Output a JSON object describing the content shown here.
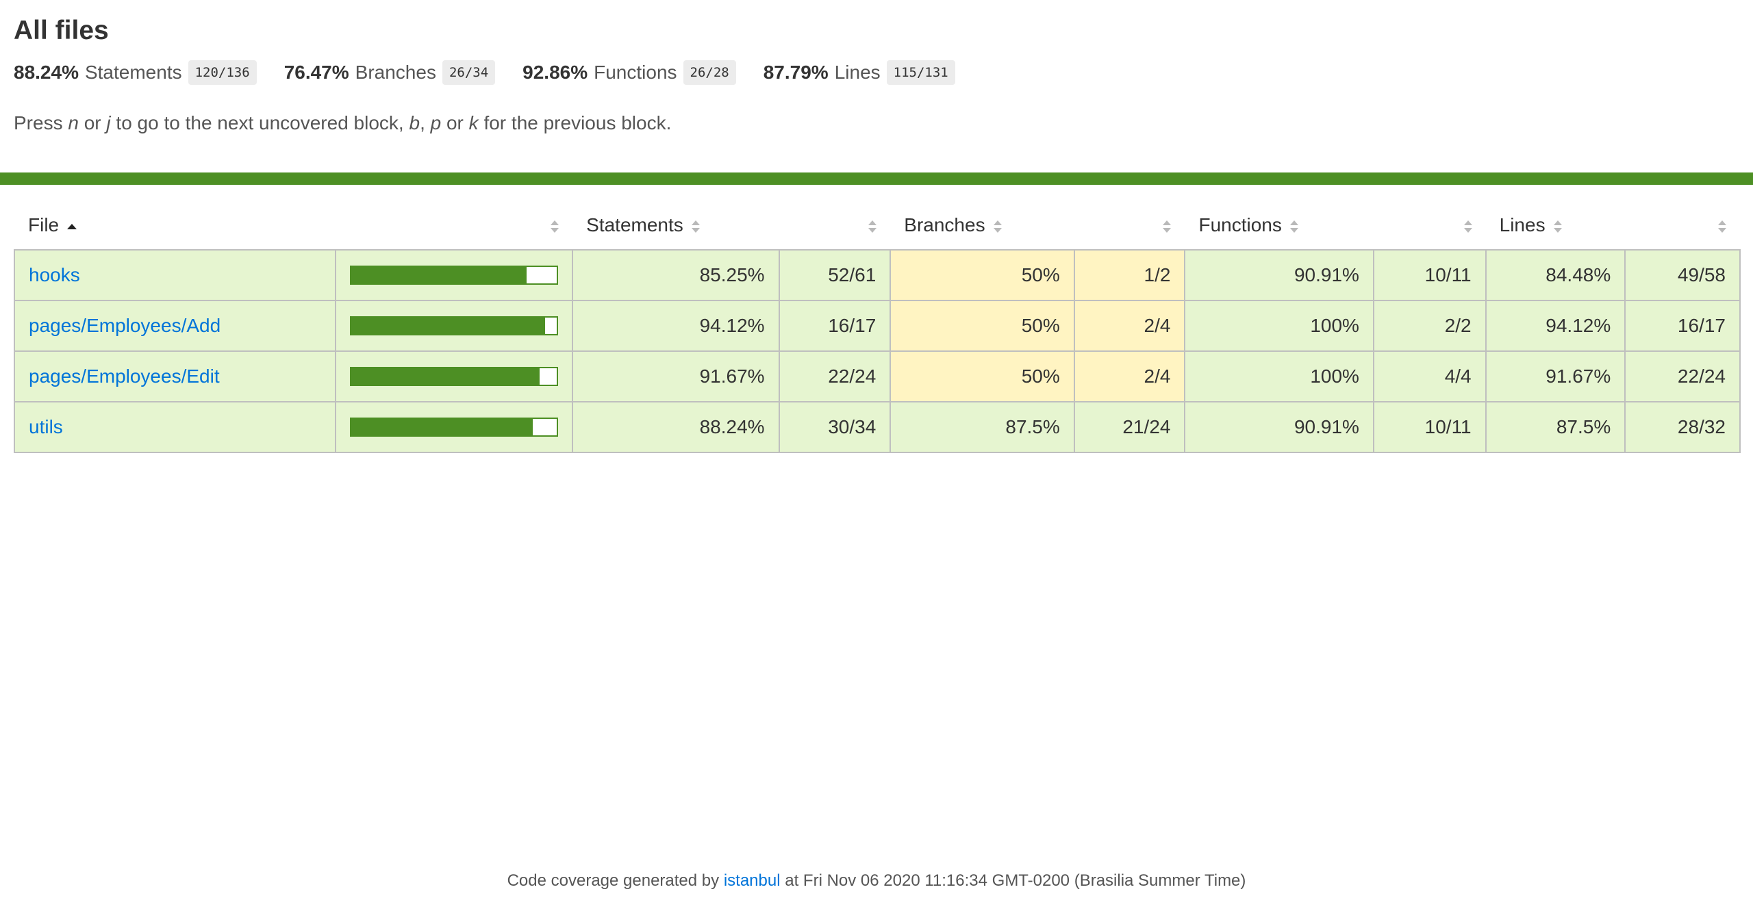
{
  "page": {
    "title": "All files"
  },
  "summary": [
    {
      "pct": "88.24%",
      "label": "Statements",
      "frac": "120/136"
    },
    {
      "pct": "76.47%",
      "label": "Branches",
      "frac": "26/34"
    },
    {
      "pct": "92.86%",
      "label": "Functions",
      "frac": "26/28"
    },
    {
      "pct": "87.79%",
      "label": "Lines",
      "frac": "115/131"
    }
  ],
  "hint": {
    "press": "Press",
    "n": "n",
    "or1": "or",
    "j": "j",
    "next": "to go to the next uncovered block,",
    "b": "b",
    "comma": ",",
    "p": "p",
    "or2": "or",
    "k": "k",
    "prev": "for the previous block."
  },
  "table": {
    "headers": {
      "file": "File",
      "statements": "Statements",
      "branches": "Branches",
      "functions": "Functions",
      "lines": "Lines"
    },
    "rows": [
      {
        "file": "hooks",
        "bar_pct": 85.25,
        "statements_pct": "85.25%",
        "statements_frac": "52/61",
        "statements_class": "high",
        "branches_pct": "50%",
        "branches_frac": "1/2",
        "branches_class": "medium",
        "functions_pct": "90.91%",
        "functions_frac": "10/11",
        "functions_class": "high",
        "lines_pct": "84.48%",
        "lines_frac": "49/58",
        "lines_class": "high"
      },
      {
        "file": "pages/Employees/Add",
        "bar_pct": 94.12,
        "statements_pct": "94.12%",
        "statements_frac": "16/17",
        "statements_class": "high",
        "branches_pct": "50%",
        "branches_frac": "2/4",
        "branches_class": "medium",
        "functions_pct": "100%",
        "functions_frac": "2/2",
        "functions_class": "high",
        "lines_pct": "94.12%",
        "lines_frac": "16/17",
        "lines_class": "high"
      },
      {
        "file": "pages/Employees/Edit",
        "bar_pct": 91.67,
        "statements_pct": "91.67%",
        "statements_frac": "22/24",
        "statements_class": "high",
        "branches_pct": "50%",
        "branches_frac": "2/4",
        "branches_class": "medium",
        "functions_pct": "100%",
        "functions_frac": "4/4",
        "functions_class": "high",
        "lines_pct": "91.67%",
        "lines_frac": "22/24",
        "lines_class": "high"
      },
      {
        "file": "utils",
        "bar_pct": 88.24,
        "statements_pct": "88.24%",
        "statements_frac": "30/34",
        "statements_class": "high",
        "branches_pct": "87.5%",
        "branches_frac": "21/24",
        "branches_class": "high",
        "functions_pct": "90.91%",
        "functions_frac": "10/11",
        "functions_class": "high",
        "lines_pct": "87.5%",
        "lines_frac": "28/32",
        "lines_class": "high"
      }
    ]
  },
  "footer": {
    "prefix": "Code coverage generated by",
    "link": "istanbul",
    "suffix": "at Fri Nov 06 2020 11:16:34 GMT-0200 (Brasilia Summer Time)"
  },
  "colors": {
    "status_high": "#4d8f24",
    "cell_high": "#e6f5d0",
    "cell_medium": "#fff4c2",
    "link": "#0074d9"
  }
}
